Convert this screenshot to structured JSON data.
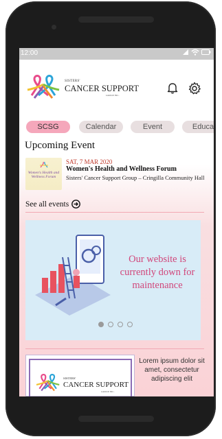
{
  "status": {
    "time": "12:00"
  },
  "header": {
    "logo_small": "SISTERS'",
    "logo_big": "CANCER SUPPORT",
    "logo_group": "GROUP INC."
  },
  "tabs": [
    {
      "label": "SCSG",
      "active": true
    },
    {
      "label": "Calendar",
      "active": false
    },
    {
      "label": "Event",
      "active": false
    },
    {
      "label": "Educat",
      "active": false
    }
  ],
  "upcoming": {
    "title": "Upcoming Event",
    "image_caption": "Women's Health and Wellness Forum",
    "date": "SAT, 7 MAR 2020",
    "event_title": "Women's Health and Wellness Forum",
    "org": "Sisters' Cancer Support Group – Cringilla Community Hall",
    "see_all": "See all events"
  },
  "banner": {
    "text": "Our website is currently down for maintenance",
    "slides": 4,
    "active_slide": 1
  },
  "card": {
    "logo_small": "SISTERS'",
    "logo_big": "CANCER SUPPORT",
    "logo_group": "GROUP INC.",
    "text": "Lorem ipsum dolor sit amet, consectetur adipiscing elit"
  }
}
